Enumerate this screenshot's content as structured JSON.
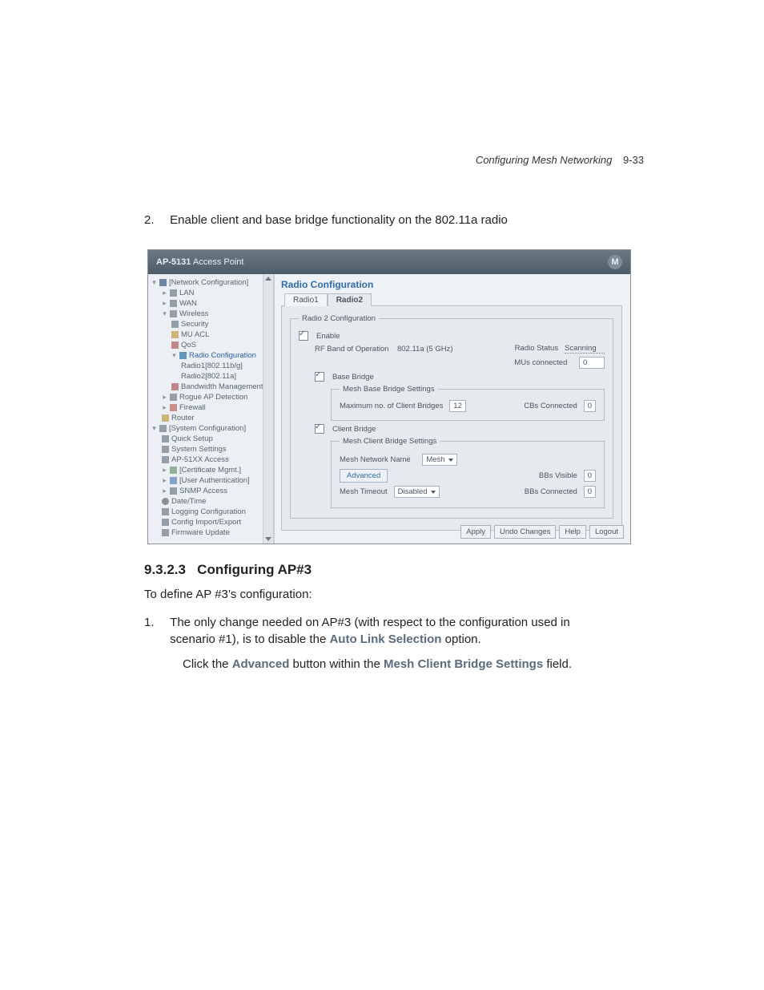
{
  "header": {
    "title": "Configuring Mesh Networking",
    "page": "9-33"
  },
  "step2": {
    "num": "2.",
    "text": "Enable client and base bridge functionality on the 802.11a radio"
  },
  "ss": {
    "product_a": "AP-5131",
    "product_b": "Access Point",
    "tree": {
      "netcfg": "[Network Configuration]",
      "lan": "LAN",
      "wan": "WAN",
      "wireless": "Wireless",
      "security": "Security",
      "muacl": "MU ACL",
      "qos": "QoS",
      "radiocfg": "Radio Configuration",
      "radio1": "Radio1[802.11b/g]",
      "radio2": "Radio2[802.11a]",
      "bwm": "Bandwidth Management",
      "rogue": "Rogue AP Detection",
      "firewall": "Firewall",
      "router": "Router",
      "syscfg": "[System Configuration]",
      "quick": "Quick Setup",
      "sysset": "System Settings",
      "ap51xx": "AP-51XX Access",
      "cert": "[Certificate Mgmt.]",
      "userauth": "[User Authentication]",
      "snmp": "SNMP Access",
      "datetime": "Date/Time",
      "logcfg": "Logging Configuration",
      "cfgie": "Config Import/Export",
      "fwup": "Firmware Update"
    },
    "main": {
      "title": "Radio Configuration",
      "tab1": "Radio1",
      "tab2": "Radio2",
      "fs_legend": "Radio 2 Configuration",
      "enable": "Enable",
      "rf_label": "RF Band of Operation",
      "rf_value": "802.11a (5 GHz)",
      "radio_status_lbl": "Radio Status",
      "radio_status_val": "Scanning",
      "mus_lbl": "MUs connected",
      "mus_val": "0",
      "basebridge": "Base Bridge",
      "mbbs_legend": "Mesh Base Bridge Settings",
      "maxcb_lbl": "Maximum no. of Client Bridges",
      "maxcb_val": "12",
      "cbs_conn_lbl": "CBs Connected",
      "cbs_conn_val": "0",
      "clientbridge": "Client Bridge",
      "mcbs_legend": "Mesh Client Bridge Settings",
      "meshnet_lbl": "Mesh Network Name",
      "meshnet_val": "Mesh",
      "advanced": "Advanced",
      "bbs_vis_lbl": "BBs Visible",
      "bbs_vis_val": "0",
      "meshto_lbl": "Mesh Timeout",
      "meshto_val": "Disabled",
      "bbs_conn_lbl": "BBs Connected",
      "bbs_conn_val": "0",
      "apply": "Apply",
      "undo": "Undo Changes",
      "help": "Help",
      "logout": "Logout"
    }
  },
  "section": {
    "heading_num": "9.3.2.3",
    "heading_txt": "Configuring AP#3",
    "intro": "To define AP #3’s configuration:",
    "step1_num": "1.",
    "step1_a": "The only change needed on AP#3 (with respect to the configuration used in scenario #1), is to disable the ",
    "step1_link": "Auto Link Selection",
    "step1_b": " option.",
    "para2_a": "Click the ",
    "para2_link1": "Advanced",
    "para2_b": " button within the ",
    "para2_link2": "Mesh Client Bridge Settings",
    "para2_c": " field."
  }
}
